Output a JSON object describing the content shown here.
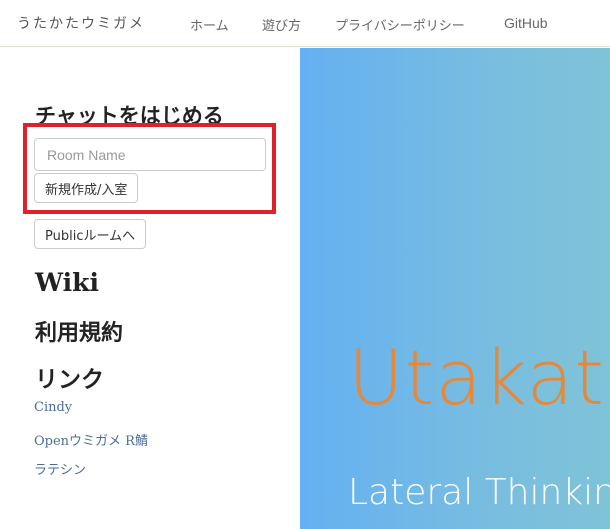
{
  "navbar": {
    "brand": "うたかたウミガメ",
    "links": [
      "ホーム",
      "遊び方",
      "プライバシーポリシー",
      "GitHub"
    ]
  },
  "sidebar": {
    "start_title": "チャットをはじめる",
    "room_input_placeholder": "Room Name",
    "create_button": "新規作成/入室",
    "public_button": "Publicルームへ",
    "wiki": "Wiki",
    "terms": "利用規約",
    "links_title": "リンク",
    "links": [
      "Cindy",
      "Openウミガメ R鯖",
      "ラテシン"
    ]
  },
  "hero": {
    "title": "Utakata",
    "subtitle": "Lateral Thinking"
  },
  "colors": {
    "highlight": "#e0202a",
    "link": "#4a6f9a",
    "hero_title": "#e5883a",
    "hero_bg_start": "#64b0f2",
    "hero_bg_end": "#7fc3d8"
  }
}
